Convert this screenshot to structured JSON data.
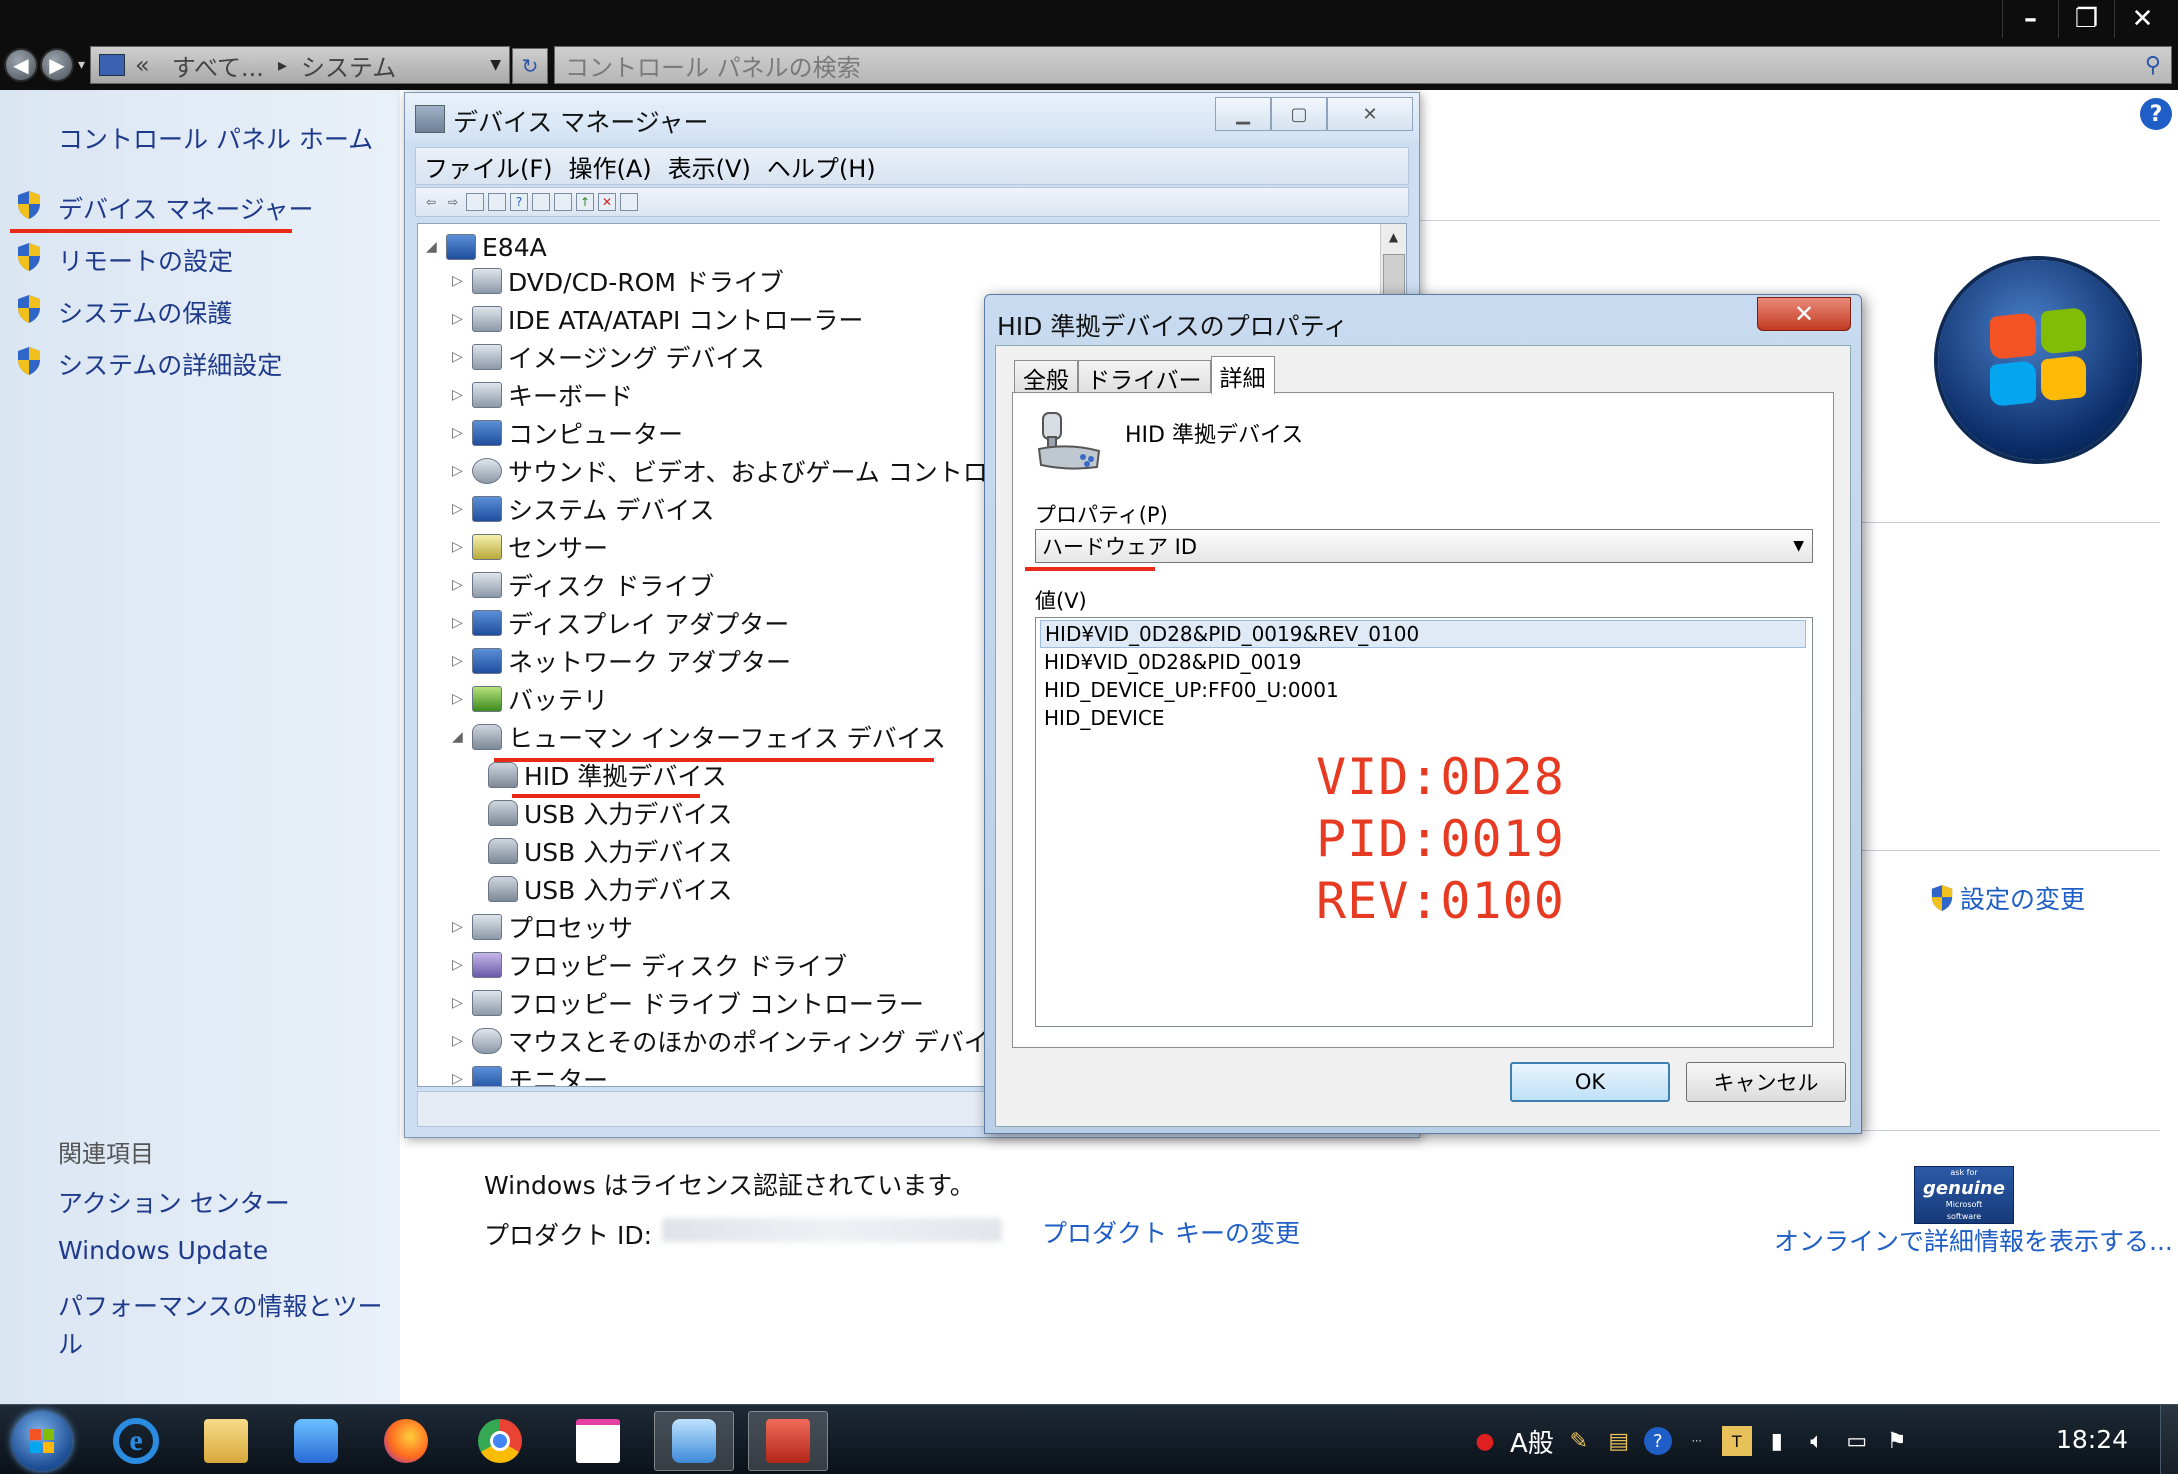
{
  "explorer": {
    "address_crumbs": [
      "«",
      "すべて...",
      "システム"
    ],
    "search_placeholder": "コントロール パネルの検索",
    "caption_buttons": {
      "minimize": "–",
      "restore": "❐",
      "close": "✕"
    }
  },
  "left_nav": {
    "home_link": "コントロール パネル ホーム",
    "tasks": [
      {
        "label": "デバイス マネージャー",
        "icon": "shield-icon",
        "highlighted": true
      },
      {
        "label": "リモートの設定",
        "icon": "shield-icon"
      },
      {
        "label": "システムの保護",
        "icon": "shield-icon"
      },
      {
        "label": "システムの詳細設定",
        "icon": "shield-icon"
      }
    ],
    "related_heading": "関連項目",
    "related_links": [
      "アクション センター",
      "Windows Update",
      "パフォーマンスの情報とツール"
    ]
  },
  "system_page": {
    "change_settings_link": "設定の変更",
    "license_status": "Windows はライセンス認証されています。",
    "product_id_label": "プロダクト ID:",
    "product_key_link": "プロダクト キーの変更",
    "genuine_badge": {
      "line1": "ask for",
      "line2": "genuine",
      "line3": "Microsoft",
      "line4": "software"
    },
    "online_info_link": "オンラインで詳細情報を表示する..."
  },
  "device_manager": {
    "title": "デバイス マネージャー",
    "menu": [
      "ファイル(F)",
      "操作(A)",
      "表示(V)",
      "ヘルプ(H)"
    ],
    "tree": {
      "root": "E84A",
      "categories": [
        "DVD/CD-ROM ドライブ",
        "IDE ATA/ATAPI コントローラー",
        "イメージング デバイス",
        "キーボード",
        "コンピューター",
        "サウンド、ビデオ、およびゲーム コントロ",
        "システム デバイス",
        "センサー",
        "ディスク ドライブ",
        "ディスプレイ アダプター",
        "ネットワーク アダプター",
        "バッテリ",
        "ヒューマン インターフェイス デバイス"
      ],
      "hid_children": [
        "HID 準拠デバイス",
        "USB 入力デバイス",
        "USB 入力デバイス",
        "USB 入力デバイス"
      ],
      "after": [
        "プロセッサ",
        "フロッピー ディスク ドライブ",
        "フロッピー ドライブ コントローラー",
        "マウスとそのほかのポインティング デバイ",
        "モニター"
      ]
    }
  },
  "properties_dialog": {
    "title": "HID 準拠デバイスのプロパティ",
    "close": "✕",
    "tabs": [
      "全般",
      "ドライバー",
      "詳細"
    ],
    "active_tab": "詳細",
    "device_name": "HID 準拠デバイス",
    "property_label": "プロパティ(P)",
    "property_selected": "ハードウェア ID",
    "value_label": "値(V)",
    "values": [
      "HID¥VID_0D28&PID_0019&REV_0100",
      "HID¥VID_0D28&PID_0019",
      "HID_DEVICE_UP:FF00_U:0001",
      "HID_DEVICE"
    ],
    "annotations": [
      "VID:0D28",
      "PID:0019",
      "REV:0100"
    ],
    "ok": "OK",
    "cancel": "キャンセル"
  },
  "taskbar": {
    "apps": [
      "start-orb",
      "internet-explorer",
      "file-explorer",
      "media-player",
      "firefox",
      "chrome",
      "paint",
      "control-panel",
      "toolbox"
    ],
    "ime_label": "A般",
    "clock": "18:24"
  },
  "colors": {
    "annotation_red": "#e63b22",
    "link_blue": "#1e5ec6",
    "nav_bg": "#dbe6f3"
  }
}
